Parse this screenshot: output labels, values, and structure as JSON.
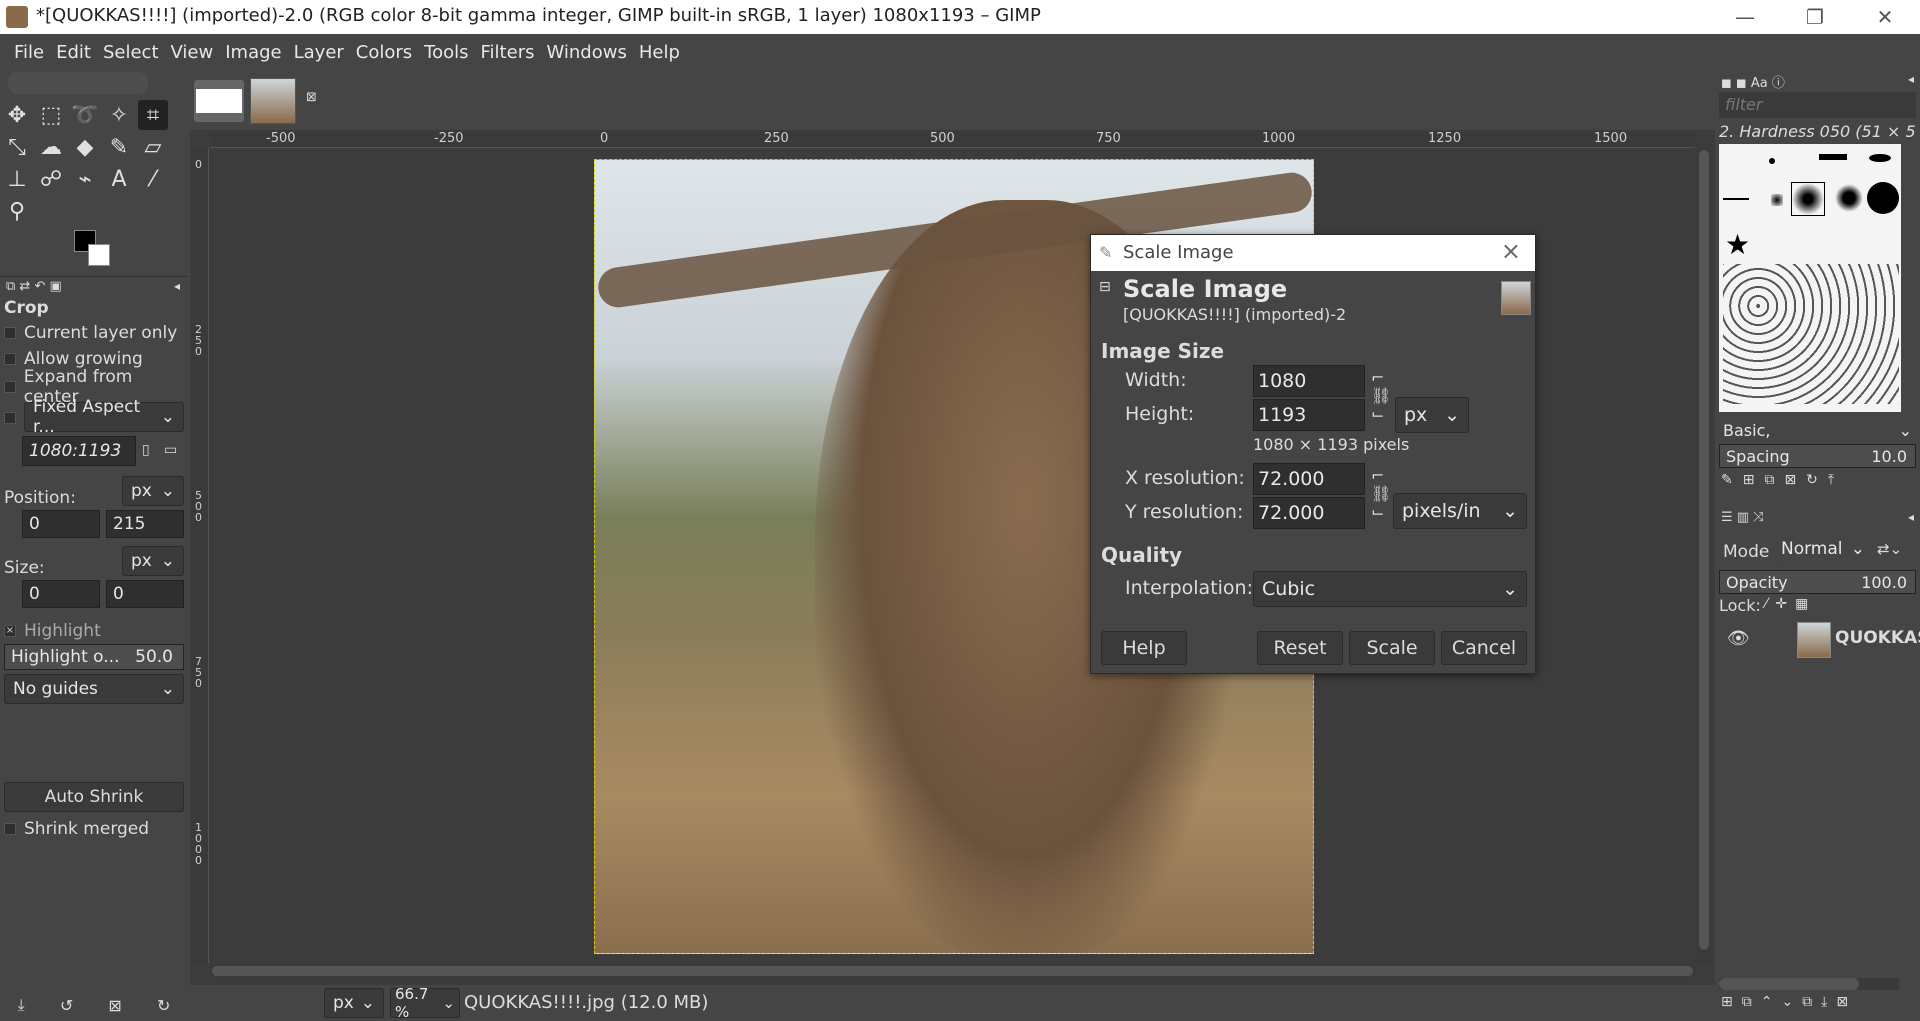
{
  "window": {
    "title": "*[QUOKKAS!!!!] (imported)-2.0 (RGB color 8-bit gamma integer, GIMP built-in sRGB, 1 layer) 1080x1193 – GIMP",
    "minimize": "—",
    "restore": "❐",
    "close": "✕"
  },
  "menu": [
    "File",
    "Edit",
    "Select",
    "View",
    "Image",
    "Layer",
    "Colors",
    "Tools",
    "Filters",
    "Windows",
    "Help"
  ],
  "tool_options": {
    "tool_name": "Crop",
    "current_layer_only": "Current layer only",
    "allow_growing": "Allow growing",
    "expand_from_center": "Expand from center",
    "fixed_aspect": "Fixed Aspect r...",
    "aspect_value": "1080:1193",
    "position_label": "Position:",
    "position_unit": "px",
    "position_x": "0",
    "position_y": "215",
    "size_label": "Size:",
    "size_unit": "px",
    "size_w": "0",
    "size_h": "0",
    "highlight": "Highlight",
    "highlight_opacity_label": "Highlight o...",
    "highlight_opacity_value": "50.0",
    "guides": "No guides",
    "auto_shrink": "Auto Shrink",
    "shrink_merged": "Shrink merged"
  },
  "rulers": {
    "h": [
      "-500",
      "-250",
      "0",
      "250",
      "500",
      "750",
      "1000",
      "1250",
      "1500"
    ],
    "v": [
      "0",
      "250",
      "500",
      "750",
      "1000"
    ]
  },
  "statusbar": {
    "unit": "px",
    "zoom": "66.7 %",
    "file_info": "QUOKKAS!!!!.jpg (12.0 MB)"
  },
  "brushes": {
    "filter_placeholder": "filter",
    "current_brush": "2. Hardness 050 (51 × 51)",
    "preset": "Basic,",
    "spacing_label": "Spacing",
    "spacing_value": "10.0"
  },
  "layers": {
    "mode_label": "Mode",
    "mode_value": "Normal",
    "opacity_label": "Opacity",
    "opacity_value": "100.0",
    "lock_label": "Lock:",
    "layer_name": "QUOKKAS"
  },
  "dialog": {
    "title": "Scale Image",
    "heading": "Scale Image",
    "subtitle": "[QUOKKAS!!!!] (imported)-2",
    "image_size_section": "Image Size",
    "width_label": "Width:",
    "width_value": "1080",
    "height_label": "Height:",
    "height_value": "1193",
    "size_unit": "px",
    "pixels_info": "1080 × 1193 pixels",
    "xres_label": "X resolution:",
    "xres_value": "72.000",
    "yres_label": "Y resolution:",
    "yres_value": "72.000",
    "res_unit": "pixels/in",
    "quality_section": "Quality",
    "interp_label": "Interpolation:",
    "interp_value": "Cubic",
    "help": "Help",
    "reset": "Reset",
    "scale": "Scale",
    "cancel": "Cancel"
  }
}
